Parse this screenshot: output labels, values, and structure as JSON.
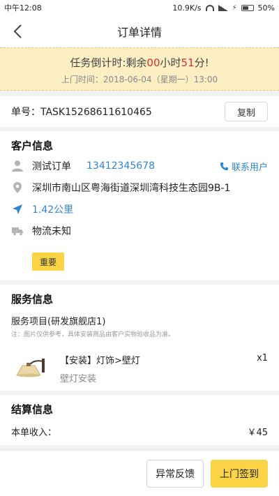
{
  "status_bar": {
    "time": "中午12:08",
    "network": "10.9K/s",
    "battery": "50%"
  },
  "navbar": {
    "title": "订单详情"
  },
  "banner": {
    "prefix": "任务倒计时:剩余",
    "hours": "00",
    "hours_unit": "小时",
    "minutes": "51",
    "minutes_unit": "分!",
    "visit_time": "上门时间：2018-06-04（星期一）13:00"
  },
  "order": {
    "number": "单号：TASK15268611610465",
    "copy_label": "复制"
  },
  "customer": {
    "title": "客户信息",
    "name": "测试订单",
    "phone": "13412345678",
    "contact_label": "联系用户",
    "address": "深圳市南山区粤海街道深圳湾科技生态园9B-1",
    "distance": "1.42公里",
    "logistics": "物流未知",
    "tag": "重要"
  },
  "service": {
    "title": "服务信息",
    "project": "服务项目(研发旗舰店1)",
    "note": "注：图片仅供参考，具体安装商品由客户实物验收品为准。",
    "product_name": "【安装】灯饰>壁灯",
    "product_qty": "x1",
    "product_sub": "壁灯安装"
  },
  "settlement": {
    "title": "结算信息",
    "income_label": "本单收入：",
    "income_value": "￥45"
  },
  "actions": {
    "feedback_label": "异常反馈",
    "signin_label": "上门签到"
  },
  "colors": {
    "accent": "#fbd445",
    "link": "#2f86d6",
    "countdown": "#e52b2b",
    "banner_bg": "#fcefc3"
  }
}
